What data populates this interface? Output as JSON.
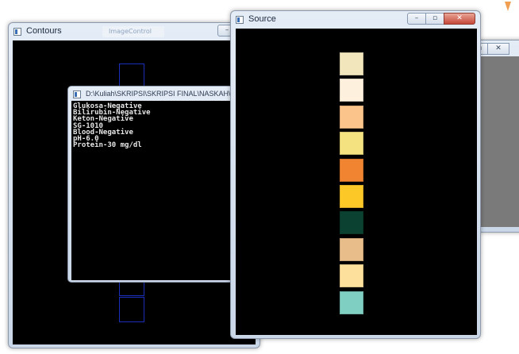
{
  "windows": {
    "contours": {
      "title": "Contours",
      "behind_tab_label": "ImageControl"
    },
    "console": {
      "title": "D:\\Kuliah\\SKRIPSI\\SKRIPSI FINAL\\NASKAH\\Avg",
      "lines": [
        "Glukosa-Negative",
        "Bilirubin-Negative",
        "Keton-Negative",
        "SG-1010",
        "Blood-Negative",
        "pH-6.0",
        "Protein-30 mg/dl"
      ]
    },
    "source": {
      "title": "Source",
      "pads": [
        "#f2e6bd",
        "#fdf1dd",
        "#fac48a",
        "#f3e27f",
        "#f18430",
        "#fcc828",
        "#0b4130",
        "#e8bd8a",
        "#fde09b",
        "#7fcfc3"
      ]
    },
    "background_window": {},
    "icons": {
      "minimize": "minimize-icon",
      "maximize": "maximize-icon",
      "close": "close-icon",
      "app": "app-icon"
    }
  }
}
